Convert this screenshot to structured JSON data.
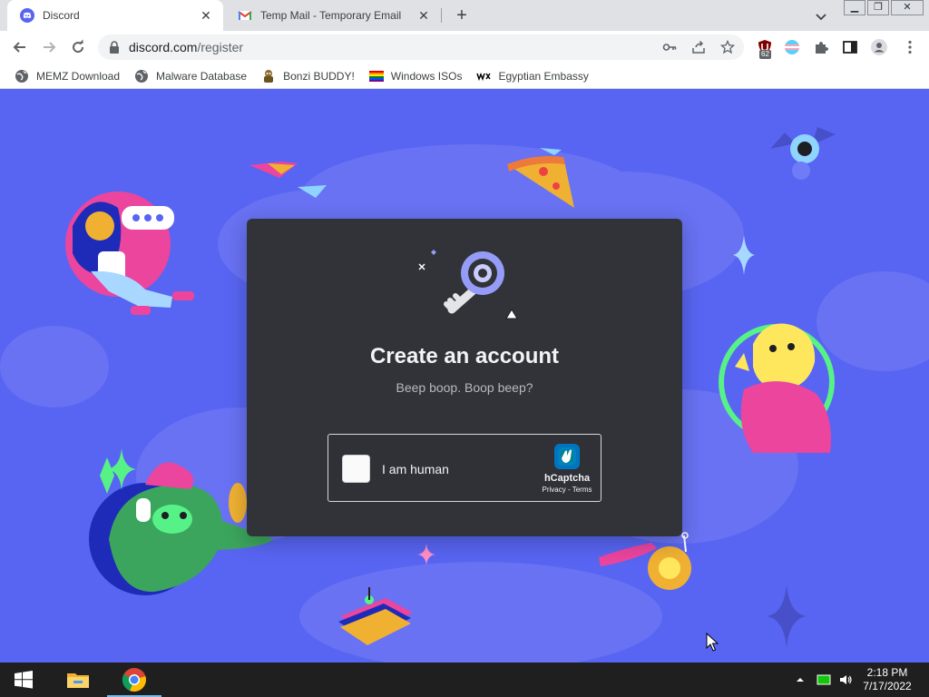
{
  "browser": {
    "tabs": [
      {
        "title": "Discord",
        "active": true,
        "icon": "discord-icon"
      },
      {
        "title": "Temp Mail - Temporary Email",
        "active": false,
        "icon": "gmail-icon"
      }
    ],
    "url_domain": "discord.com",
    "url_path": "/register",
    "extension_badge": "62",
    "bookmarks": [
      {
        "label": "MEMZ Download",
        "icon": "globe-icon"
      },
      {
        "label": "Malware Database",
        "icon": "globe-icon"
      },
      {
        "label": "Bonzi BUDDY!",
        "icon": "bonzi-icon"
      },
      {
        "label": "Windows ISOs",
        "icon": "pride-flag-icon"
      },
      {
        "label": "Egyptian Embassy",
        "icon": "wix-icon"
      }
    ]
  },
  "register": {
    "title": "Create an account",
    "subtitle": "Beep boop. Boop beep?",
    "captcha": {
      "label": "I am human",
      "brand": "hCaptcha",
      "links": "Privacy - Terms"
    }
  },
  "colors": {
    "blurple": "#5865f2",
    "card": "#313338",
    "title": "#f2f3f5",
    "subtitle": "#b5bac1"
  },
  "taskbar": {
    "time": "2:18 PM",
    "date": "7/17/2022"
  }
}
